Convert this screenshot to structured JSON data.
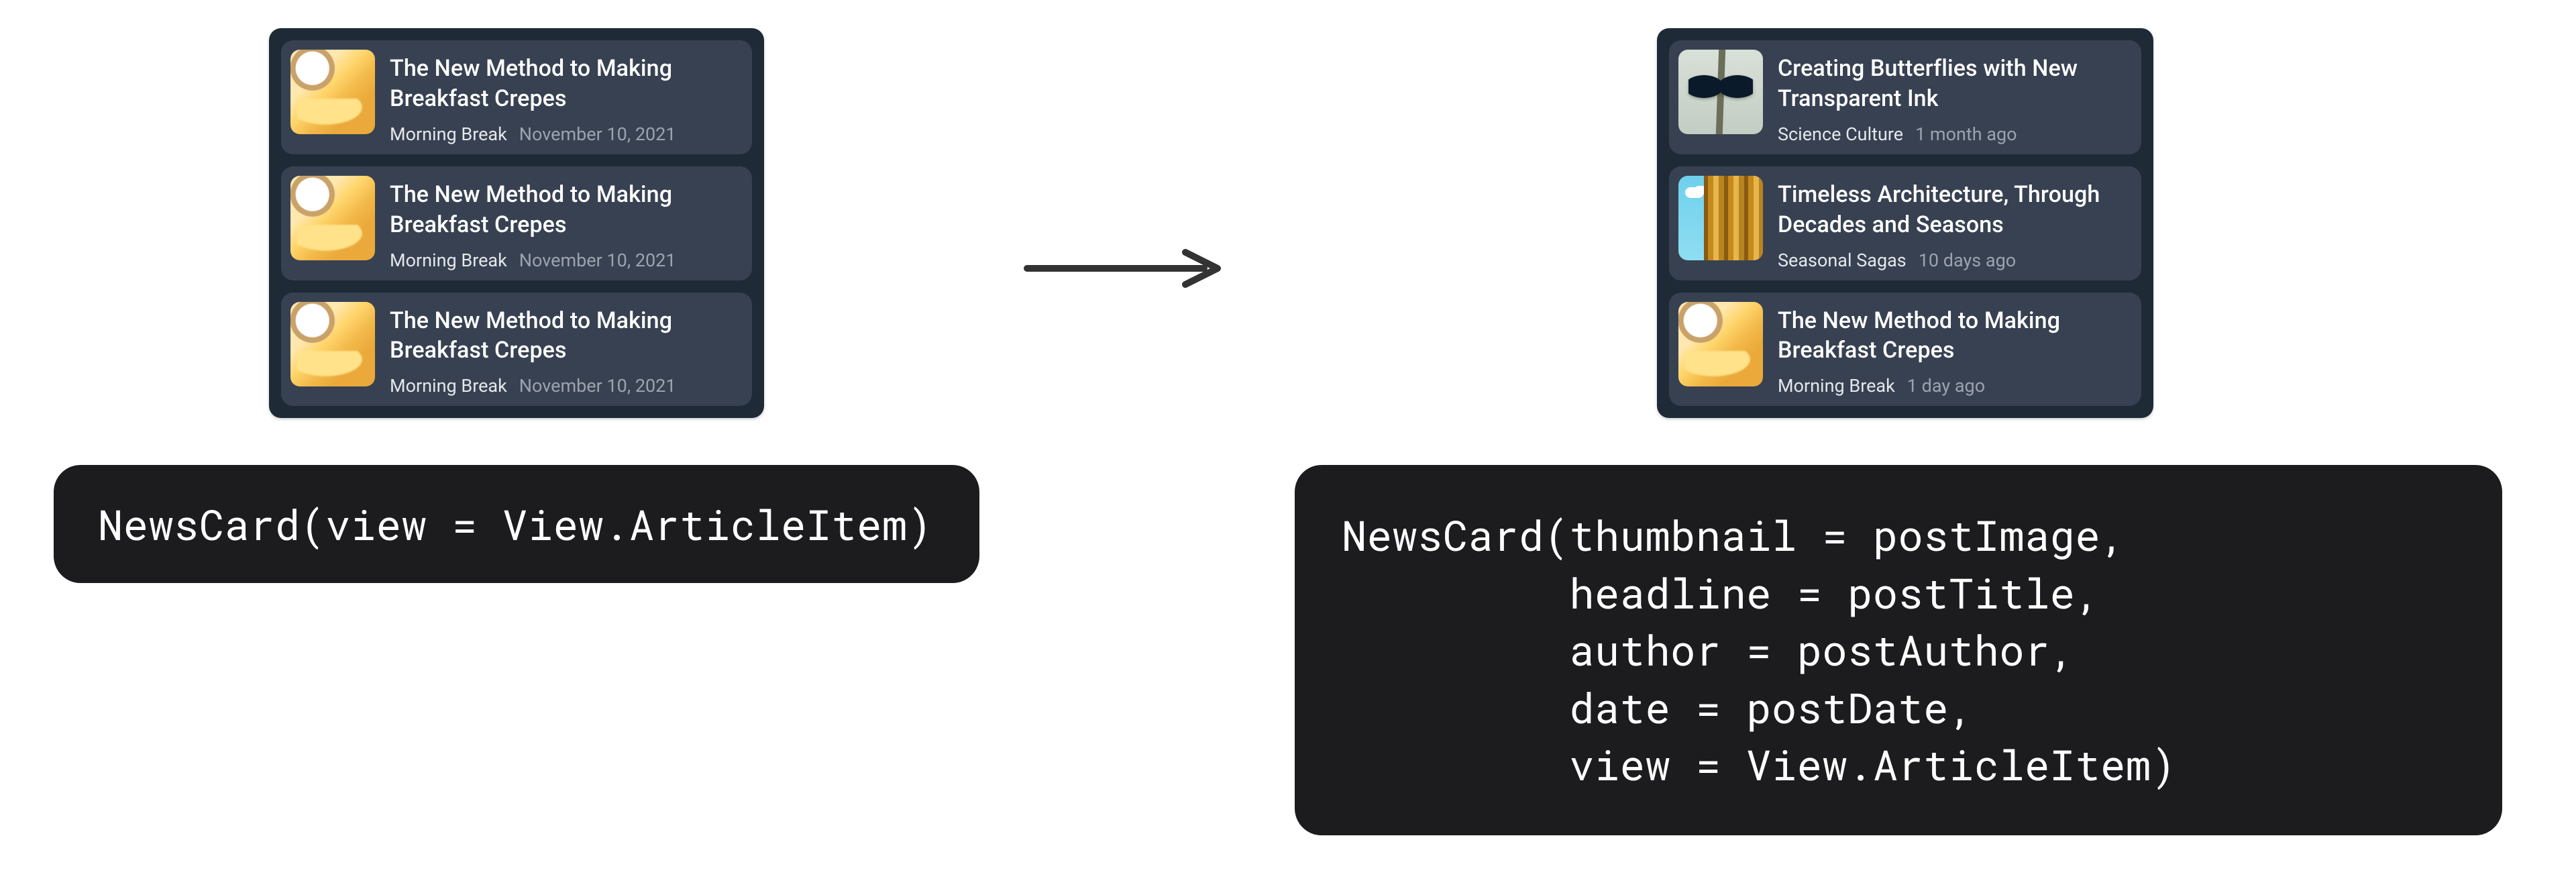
{
  "left_list": {
    "items": [
      {
        "thumb": "crepe",
        "headline": "The New Method to Making Breakfast Crepes",
        "author": "Morning Break",
        "date": "November 10, 2021"
      },
      {
        "thumb": "crepe",
        "headline": "The New Method to Making Breakfast Crepes",
        "author": "Morning Break",
        "date": "November 10, 2021"
      },
      {
        "thumb": "crepe",
        "headline": "The New Method to Making Breakfast Crepes",
        "author": "Morning Break",
        "date": "November 10, 2021"
      }
    ]
  },
  "right_list": {
    "items": [
      {
        "thumb": "butterfly",
        "headline": "Creating Butterflies with New Transparent Ink",
        "author": "Science Culture",
        "date": "1 month ago"
      },
      {
        "thumb": "arch",
        "headline": "Timeless Architecture, Through Decades and Seasons",
        "author": "Seasonal Sagas",
        "date": "10 days ago"
      },
      {
        "thumb": "crepe",
        "headline": "The New Method to Making Breakfast Crepes",
        "author": "Morning Break",
        "date": "1 day ago"
      }
    ]
  },
  "code_left": "NewsCard(view = View.ArticleItem)",
  "code_right": "NewsCard(thumbnail = postImage,\n         headline = postTitle,\n         author = postAuthor,\n         date = postDate,\n         view = View.ArticleItem)"
}
